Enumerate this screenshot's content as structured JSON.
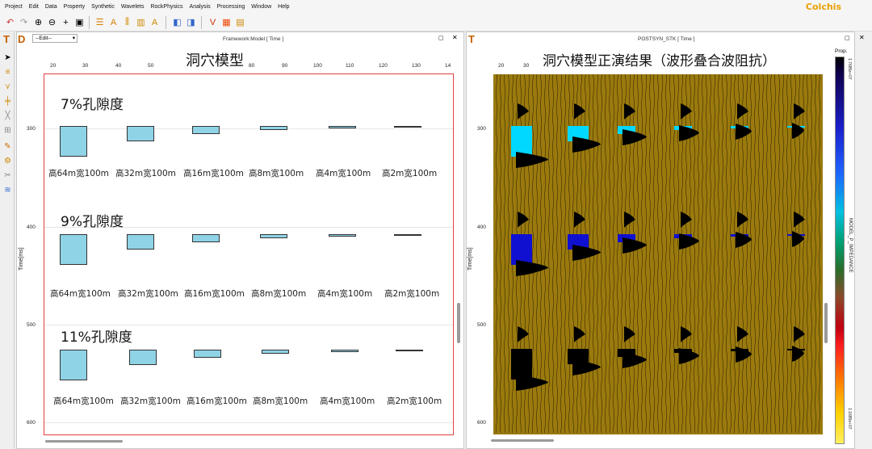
{
  "menu": [
    "Project",
    "Edit",
    "Data",
    "Property",
    "Synthetic",
    "Wavelets",
    "RockPhysics",
    "Analysis",
    "Processing",
    "Window",
    "Help"
  ],
  "brand": "Colchis",
  "left_panel": {
    "mode_select": "--Edit--",
    "title": "Framework:Model [ Time ]",
    "big_title": "洞穴模型",
    "x_ticks": [
      "20",
      "30",
      "40",
      "50",
      "80",
      "90",
      "100",
      "110",
      "120",
      "130",
      "14"
    ],
    "y_ticks": [
      "300",
      "400",
      "500",
      "600"
    ],
    "y_label": "Time[ms]",
    "sections": [
      {
        "title": "7%孔隙度",
        "labels": [
          "高64m宽100m",
          "高32m宽100m",
          "高16m宽100m",
          "高8m宽100m",
          "高4m宽100m",
          "高2m宽100m"
        ]
      },
      {
        "title": "9%孔隙度",
        "labels": [
          "高64m宽100m",
          "高32m宽100m",
          "高16m宽100m",
          "高8m宽100m",
          "高4m宽100m",
          "高2m宽100m"
        ]
      },
      {
        "title": "11%孔隙度",
        "labels": [
          "高64m宽100m",
          "高32m宽100m",
          "高16m宽100m",
          "高8m宽100m",
          "高4m宽100m",
          "高2m宽100m"
        ]
      }
    ]
  },
  "right_panel": {
    "title": "POSTSYN_STK [ Time ]",
    "big_title": "洞穴模型正演结果（波形叠合波阻抗）",
    "x_ticks": [
      "20",
      "30"
    ],
    "y_ticks": [
      "300",
      "400",
      "500",
      "600"
    ],
    "y_label": "Time[ms]",
    "prop_label": "Prop.",
    "colorbar_label": "MODEL_P_IMPEDANCE",
    "colorbar_top": "1.7685e+07",
    "colorbar_bottom": "1.1685e+07"
  },
  "colors": {
    "cave_fill": "#8fd3e6",
    "seismic_bg": "#9a7a0e",
    "frame_red": "#e04040"
  }
}
